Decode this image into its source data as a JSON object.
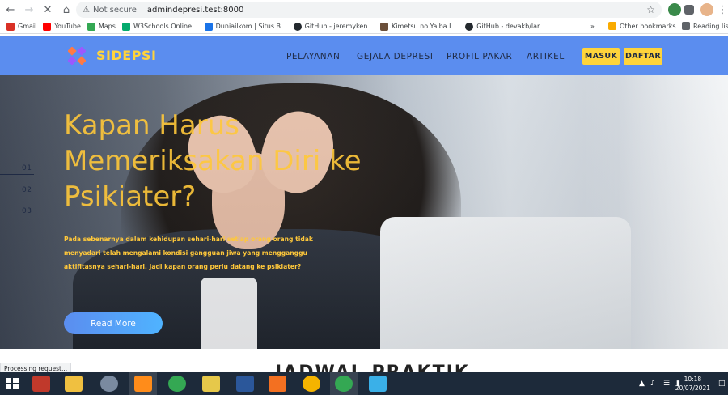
{
  "browser": {
    "security_label": "Not secure",
    "url": "admindepresi.test:8000",
    "bookmarks": [
      {
        "label": "Gmail",
        "color": "#d93025"
      },
      {
        "label": "YouTube",
        "color": "#ff0000"
      },
      {
        "label": "Maps",
        "color": "#34a853"
      },
      {
        "label": "W3Schools Online...",
        "color": "#04aa6d"
      },
      {
        "label": "Duniailkom | Situs B...",
        "color": "#1a73e8"
      },
      {
        "label": "GitHub - jeremyken...",
        "color": "#24292e"
      },
      {
        "label": "Kimetsu no Yaiba L...",
        "color": "#6b4f3a"
      },
      {
        "label": "GitHub - devakb/lar...",
        "color": "#24292e"
      }
    ],
    "more_label": "»",
    "other_bookmarks": "Other bookmarks",
    "reading_list": "Reading list"
  },
  "site": {
    "brand": "SIDEPSI",
    "menu": [
      "PELAYANAN",
      "GEJALA DEPRESI",
      "PROFIL PAKAR",
      "ARTIKEL"
    ],
    "login_label": "MASUK",
    "register_label": "DAFTAR",
    "colors": {
      "header": "#5b8def",
      "accent": "#ffd43b",
      "title": "#ffc83a"
    }
  },
  "hero": {
    "slides": [
      "01",
      "02",
      "03"
    ],
    "active_slide": "01",
    "title": "Kapan Harus Memeriksakan Diri ke Psikiater?",
    "description": "Pada sebenarnya dalam kehidupan sehari-hari setiap orang orang tidak menyadari telah mengalami kondisi gangguan jiwa yang mengganggu aktifitasnya sehari-hari. Jadi kapan orang perlu datang ke psikiater?",
    "button": "Read More"
  },
  "section_peek": "JADWAL PRAKTIK",
  "status_bar": "Processing request...",
  "taskbar": {
    "time": "10:18",
    "date": "20/07/2021"
  }
}
